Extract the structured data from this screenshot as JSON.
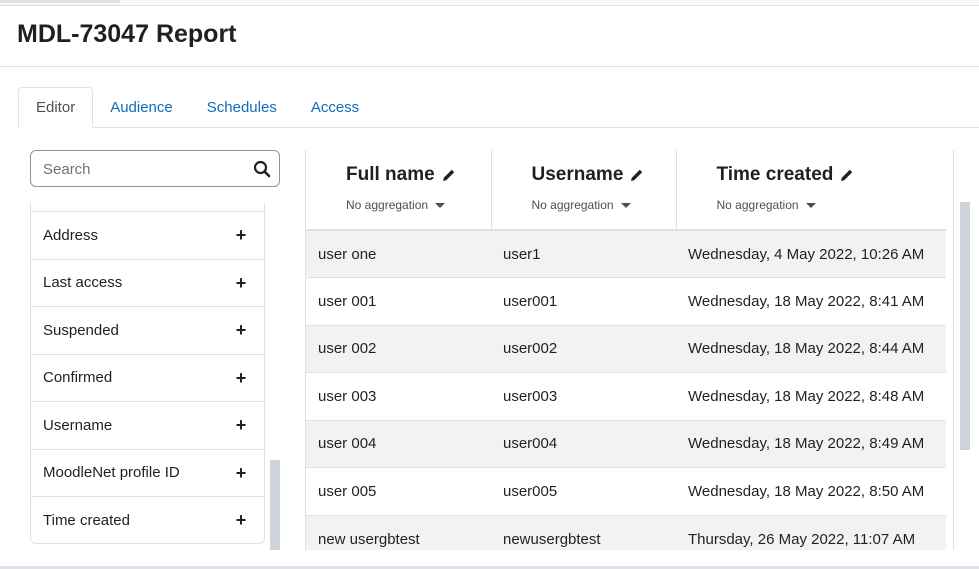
{
  "page": {
    "title": "MDL-73047 Report"
  },
  "tabs": [
    {
      "label": "Editor",
      "active": true
    },
    {
      "label": "Audience",
      "active": false
    },
    {
      "label": "Schedules",
      "active": false
    },
    {
      "label": "Access",
      "active": false
    }
  ],
  "sidebar": {
    "search_placeholder": "Search",
    "search_icon": "search-icon",
    "items": [
      {
        "label": "Address"
      },
      {
        "label": "Last access"
      },
      {
        "label": "Suspended"
      },
      {
        "label": "Confirmed"
      },
      {
        "label": "Username"
      },
      {
        "label": "MoodleNet profile ID"
      },
      {
        "label": "Time created"
      }
    ],
    "add_icon": "plus-icon"
  },
  "table": {
    "columns": [
      {
        "title": "Full name",
        "aggregation": "No aggregation",
        "edit_icon": "pencil-icon"
      },
      {
        "title": "Username",
        "aggregation": "No aggregation",
        "edit_icon": "pencil-icon"
      },
      {
        "title": "Time created",
        "aggregation": "No aggregation",
        "edit_icon": "pencil-icon"
      }
    ],
    "rows": [
      [
        "user one",
        "user1",
        "Wednesday, 4 May 2022, 10:26 AM"
      ],
      [
        "user 001",
        "user001",
        "Wednesday, 18 May 2022, 8:41 AM"
      ],
      [
        "user 002",
        "user002",
        "Wednesday, 18 May 2022, 8:44 AM"
      ],
      [
        "user 003",
        "user003",
        "Wednesday, 18 May 2022, 8:48 AM"
      ],
      [
        "user 004",
        "user004",
        "Wednesday, 18 May 2022, 8:49 AM"
      ],
      [
        "user 005",
        "user005",
        "Wednesday, 18 May 2022, 8:50 AM"
      ],
      [
        "new usergbtest",
        "newusergbtest",
        "Thursday, 26 May 2022, 11:07 AM"
      ]
    ]
  },
  "colors": {
    "link": "#0f6cbf",
    "text": "#1d2125",
    "border": "#dee2e6",
    "stripe": "#f2f2f2"
  }
}
